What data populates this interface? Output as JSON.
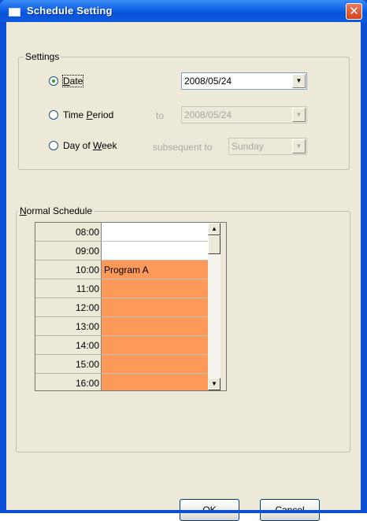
{
  "window": {
    "title": "Schedule Setting",
    "close_glyph": "✕"
  },
  "settings": {
    "group_label": "Settings",
    "date": {
      "label_pre": "",
      "mnemonic": "D",
      "label_post": "ate",
      "value": "2008/05/24",
      "selected": true
    },
    "time_period": {
      "label_pre": "Time ",
      "mnemonic": "P",
      "label_post": "eriod",
      "to_label": "to",
      "value": "2008/05/24",
      "selected": false
    },
    "day_of_week": {
      "label_pre": "Day of ",
      "mnemonic": "W",
      "label_post": "eek",
      "subsequent_label": "subsequent to",
      "value": "Sunday",
      "selected": false
    }
  },
  "schedule": {
    "group_label_mnemonic": "N",
    "group_label_rest": "ormal Schedule",
    "rows": [
      {
        "time": "08:00",
        "program": "",
        "filled": false
      },
      {
        "time": "09:00",
        "program": "",
        "filled": false
      },
      {
        "time": "10:00",
        "program": "Program A",
        "filled": true
      },
      {
        "time": "11:00",
        "program": "",
        "filled": true
      },
      {
        "time": "12:00",
        "program": "",
        "filled": true
      },
      {
        "time": "13:00",
        "program": "",
        "filled": true
      },
      {
        "time": "14:00",
        "program": "",
        "filled": true
      },
      {
        "time": "15:00",
        "program": "",
        "filled": true
      },
      {
        "time": "16:00",
        "program": "",
        "filled": true
      }
    ]
  },
  "buttons": {
    "ok": "OK",
    "cancel": "Cancel"
  },
  "icons": {
    "combo_arrow": "▼",
    "scroll_up": "▲",
    "scroll_down": "▼"
  },
  "colors": {
    "program_fill": "#fd9a5a",
    "title_bar": "#0a54d8"
  }
}
